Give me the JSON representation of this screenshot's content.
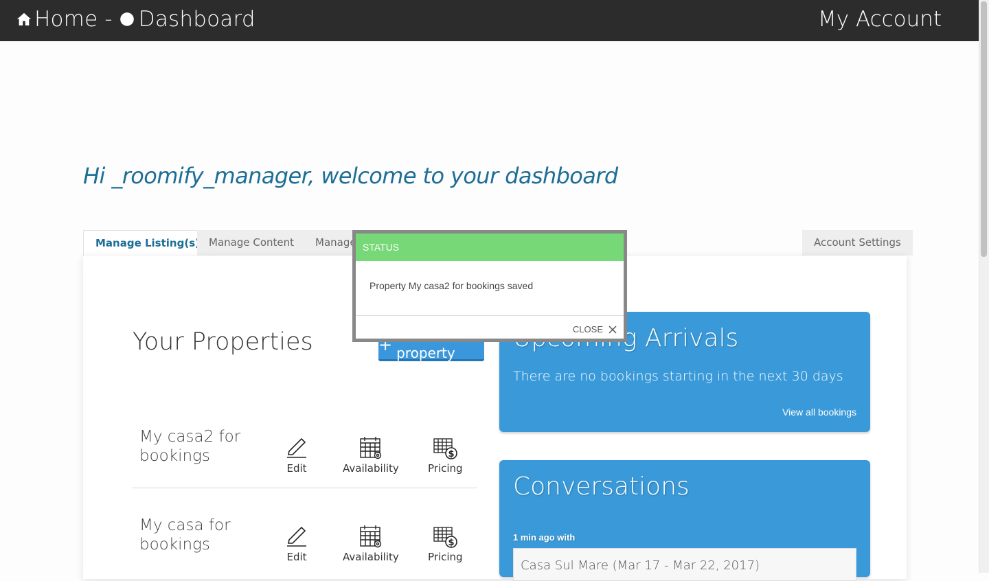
{
  "topbar": {
    "home_label": "Home",
    "separator": "-",
    "dashboard_label": "Dashboard",
    "account_label": "My Account"
  },
  "welcome": "Hi _roomify_manager, welcome to your dashboard",
  "tabs": [
    {
      "label": "Manage Listing(s)",
      "active": true
    },
    {
      "label": "Manage Content",
      "active": false
    },
    {
      "label": "Manage",
      "active": false
    },
    {
      "label": "Account Settings",
      "active": false
    }
  ],
  "properties": {
    "title": "Your Properties",
    "add_label": "add property",
    "add_plus": "+",
    "items": [
      {
        "name": "My casa2 for bookings",
        "edit": "Edit",
        "availability": "Availability",
        "pricing": "Pricing"
      },
      {
        "name": "My casa for bookings",
        "edit": "Edit",
        "availability": "Availability",
        "pricing": "Pricing"
      }
    ]
  },
  "arrivals": {
    "title": "Upcoming Arrivals",
    "message": "There are no bookings starting in the next 30 days",
    "link": "View all bookings"
  },
  "conversations": {
    "title": "Conversations",
    "meta": "1 min ago with",
    "item": "Casa Sul Mare (Mar 17 - Mar 22, 2017)"
  },
  "modal": {
    "header": "STATUS",
    "message": "Property My casa2 for bookings saved",
    "close_label": "CLOSE"
  },
  "colors": {
    "topbar": "#2c2c2c",
    "accent_blue": "#3a9ad9",
    "welcome_text": "#1d6e96",
    "status_green": "#77d877"
  }
}
